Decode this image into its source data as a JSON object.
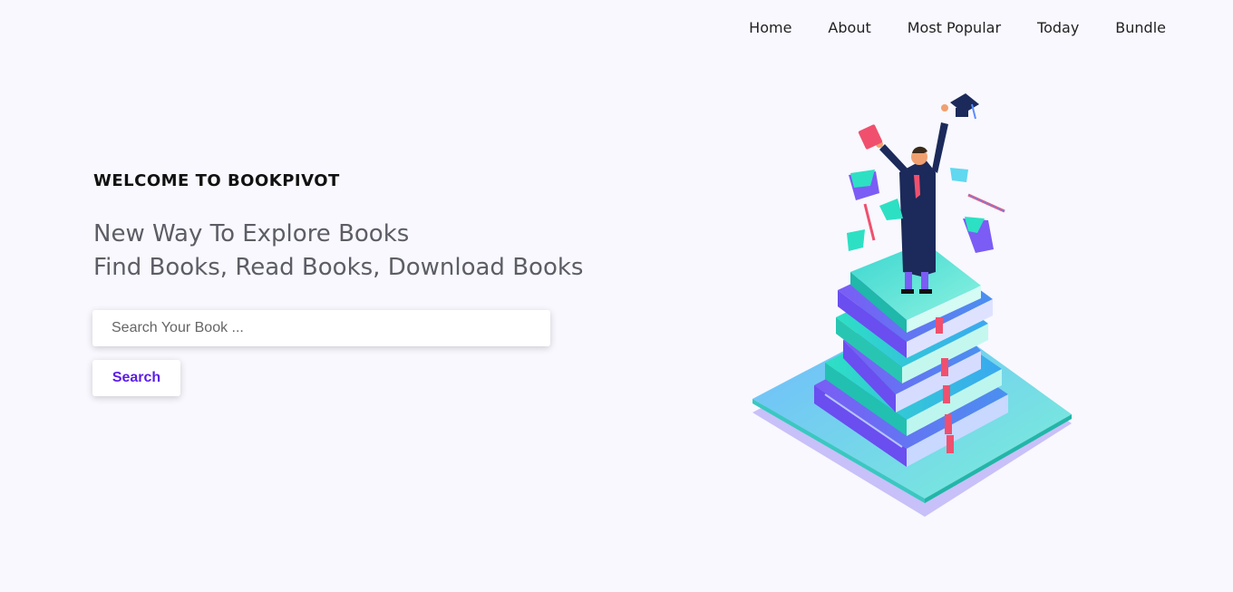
{
  "nav": {
    "items": [
      {
        "label": "Home"
      },
      {
        "label": "About"
      },
      {
        "label": "Most Popular"
      },
      {
        "label": "Today"
      },
      {
        "label": "Bundle"
      }
    ]
  },
  "hero": {
    "eyebrow": "WELCOME TO BOOKPIVOT",
    "headline_line1": "New Way To Explore Books",
    "headline_line2": "Find Books, Read Books, Download Books"
  },
  "search": {
    "placeholder": "Search Your Book ...",
    "value": "",
    "button_label": "Search"
  },
  "colors": {
    "background": "#f8f8fe",
    "accent": "#5b1ee6",
    "teal": "#2de0c4",
    "blue": "#4a7cf0",
    "purple": "#7b5cf5"
  }
}
